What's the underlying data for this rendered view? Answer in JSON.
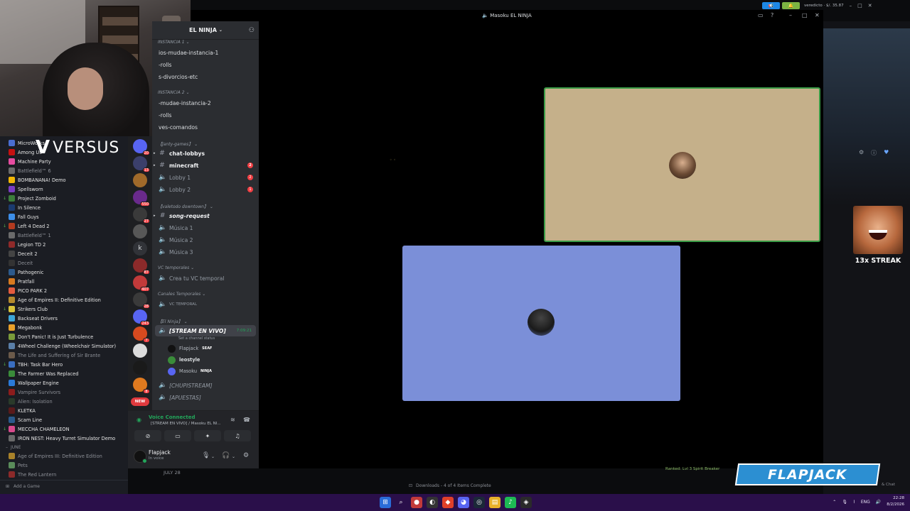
{
  "versus_overlay": {
    "mark": "V",
    "text": "VERSUS"
  },
  "steam": {
    "games": [
      {
        "name": "MicroWorks",
        "color": "#4a6ed1",
        "dl": false,
        "dim": false
      },
      {
        "name": "Among Us",
        "color": "#c51111",
        "dl": false,
        "dim": false
      },
      {
        "name": "Machine Party",
        "color": "#e64ca0",
        "dl": false,
        "dim": false
      },
      {
        "name": "Battlefield™ 6",
        "color": "#6b6b6b",
        "dl": false,
        "dim": true
      },
      {
        "name": "BOMBANANA! Demo",
        "color": "#f2b705",
        "dl": false,
        "dim": false
      },
      {
        "name": "Spellsworn",
        "color": "#7a3cc2",
        "dl": false,
        "dim": false
      },
      {
        "name": "Project Zomboid",
        "color": "#3c7d3a",
        "dl": true,
        "dim": false
      },
      {
        "name": "In Silence",
        "color": "#1b3b6f",
        "dl": false,
        "dim": false
      },
      {
        "name": "Fall Guys",
        "color": "#3d8ee8",
        "dl": false,
        "dim": false
      },
      {
        "name": "Left 4 Dead 2",
        "color": "#b23a1f",
        "dl": true,
        "dim": false
      },
      {
        "name": "Battlefield™ 1",
        "color": "#6b6b6b",
        "dl": false,
        "dim": true
      },
      {
        "name": "Legion TD 2",
        "color": "#8f2a2a",
        "dl": false,
        "dim": false
      },
      {
        "name": "Deceit 2",
        "color": "#444",
        "dl": false,
        "dim": false
      },
      {
        "name": "Deceit",
        "color": "#333",
        "dl": false,
        "dim": true
      },
      {
        "name": "Pathogenic",
        "color": "#2d5a8c",
        "dl": false,
        "dim": false
      },
      {
        "name": "Pratfall",
        "color": "#d87a1f",
        "dl": false,
        "dim": false
      },
      {
        "name": "PICO PARK 2",
        "color": "#e25b3e",
        "dl": false,
        "dim": false
      },
      {
        "name": "Age of Empires II: Definitive Edition",
        "color": "#b38a2d",
        "dl": false,
        "dim": false
      },
      {
        "name": "Strikers Club",
        "color": "#d9c33a",
        "dl": true,
        "dim": false
      },
      {
        "name": "Backseat Drivers",
        "color": "#3da6d8",
        "dl": false,
        "dim": false
      },
      {
        "name": "Megabonk",
        "color": "#e8a02a",
        "dl": false,
        "dim": false
      },
      {
        "name": "Don't Panic! It is Just Turbulence",
        "color": "#7a9b3a",
        "dl": false,
        "dim": false
      },
      {
        "name": "4Wheel Challenge (Wheelchair Simulator)",
        "color": "#5a7fa8",
        "dl": false,
        "dim": false
      },
      {
        "name": "The Life and Suffering of Sir Brante",
        "color": "#6b5a4a",
        "dl": false,
        "dim": true
      },
      {
        "name": "TBH: Task Bar Hero",
        "color": "#3a6ec1",
        "dl": true,
        "dim": false
      },
      {
        "name": "The Farmer Was Replaced",
        "color": "#3a8c3a",
        "dl": false,
        "dim": false
      },
      {
        "name": "Wallpaper Engine",
        "color": "#2a7ad8",
        "dl": false,
        "dim": false
      },
      {
        "name": "Vampire Survivors",
        "color": "#8c1c1c",
        "dl": false,
        "dim": true
      },
      {
        "name": "Alien: Isolation",
        "color": "#2a3a2a",
        "dl": false,
        "dim": true
      },
      {
        "name": "KLETKA",
        "color": "#5a1a1a",
        "dl": false,
        "dim": false
      },
      {
        "name": "Scam Line",
        "color": "#2a5a8c",
        "dl": false,
        "dim": false
      },
      {
        "name": "MECCHA CHAMELEON",
        "color": "#d84a8c",
        "dl": true,
        "dim": false
      },
      {
        "name": "IRON NEST: Heavy Turret Simulator Demo",
        "color": "#6a6a6a",
        "dl": false,
        "dim": false
      }
    ],
    "month_june": "JUNE",
    "games_after": [
      {
        "name": "Age of Empires III: Definitive Edition",
        "color": "#a8822a",
        "dl": false,
        "dim": true
      },
      {
        "name": "Pets",
        "color": "#5a8c5a",
        "dl": false,
        "dim": true
      },
      {
        "name": "The Red Lantern",
        "color": "#8c2a2a",
        "dl": false,
        "dim": true
      }
    ],
    "add_game": "Add a Game",
    "month_july": "JULY 28",
    "downloads": "Downloads - 4 of 4 Items Complete",
    "friend_activity": "Ranked: Lvl 3 Spirit Breaker",
    "friends_chat": "& Chat"
  },
  "discord": {
    "server_name": "EL NINJA",
    "servers": [
      {
        "color": "#5865f2",
        "badge": "20"
      },
      {
        "color": "#3b3f6b",
        "badge": "13"
      },
      {
        "color": "#a06a2a",
        "badge": ""
      },
      {
        "color": "#6a2a8c",
        "badge": "550"
      },
      {
        "color": "#3a3a3a",
        "badge": "27"
      },
      {
        "color": "#575757",
        "badge": ""
      },
      {
        "color": "k",
        "badge": ""
      },
      {
        "color": "#8c2a2a",
        "badge": "87"
      },
      {
        "color": "#c23a3a",
        "badge": "407"
      },
      {
        "color": "#3a3a3a",
        "badge": "28"
      },
      {
        "color": "#5865f2",
        "badge": "243"
      },
      {
        "color": "#d84a1f",
        "badge": "7"
      },
      {
        "color": "#dcdcdc",
        "badge": ""
      },
      {
        "color": "#1a1a1a",
        "badge": ""
      },
      {
        "color": "#e07a1f",
        "badge": "8"
      }
    ],
    "new_label": "NEW",
    "categories": [
      {
        "label": "INSTANCIA 1"
      },
      {
        "label": "INSTANCIA 2"
      },
      {
        "label": "【Janty-games】"
      },
      {
        "label": "【valetodo downtown】"
      },
      {
        "label": "VC temporales"
      },
      {
        "label": "Canales Temporales"
      },
      {
        "label": "【El Ninja】"
      }
    ],
    "channels": {
      "c1": "ios-mudae-instancia-1",
      "c2": "-rolls",
      "c3": "s-divorcios-etc",
      "c4": "-mudae-instancia-2",
      "c5": "-rolls",
      "c6": "ves-comandos",
      "chat_lobbys": "chat-lobbys",
      "minecraft": "minecraft",
      "lobby1": "Lobby 1",
      "lobby2": "Lobby 2",
      "song_request": "song-request",
      "musica1": "Música 1",
      "musica2": "Música 2",
      "musica3": "Música 3",
      "crea_vc": "Crea tu VC temporal",
      "vc_temporal": "VC TEMPORAL",
      "stream_en_vivo": "[STREAM EN VIVO]",
      "stream_timer": "7:09:21",
      "set_status": "Set a channel status",
      "chupistream": "[CHUPISTREAM]",
      "apuestas": "[APUESTAS]"
    },
    "badges": {
      "minecraft": "2",
      "lobby1": "2",
      "lobby2": "1"
    },
    "voice_users": [
      {
        "name": "Flapjack",
        "tag": "SEAF",
        "color": "#111"
      },
      {
        "name": "leostyle",
        "tag": "",
        "color": "#3a8c3a"
      },
      {
        "name": "Masoku",
        "tag": "NINJA",
        "color": "#5865f2"
      }
    ],
    "voice_panel": {
      "title": "Voice Connected",
      "subtitle": "[STREAM EN VIVO] / Masoku EL NI..."
    },
    "user_panel": {
      "name": "Flapjack",
      "status": "In voice"
    }
  },
  "call": {
    "title": "Masoku EL NINJA",
    "tile1_color": "#c5b08a",
    "tile2_color": "#7b8fd8",
    "speaking_color": "#3a9b46"
  },
  "topright": {
    "version": "veredicto · $/. 35.87"
  },
  "overlays": {
    "streak": "13x STREAK",
    "flapjack": "FLAPJACK"
  },
  "taskbar": {
    "lang": "ENG",
    "time": "22:28",
    "date": "8/2/2026"
  }
}
